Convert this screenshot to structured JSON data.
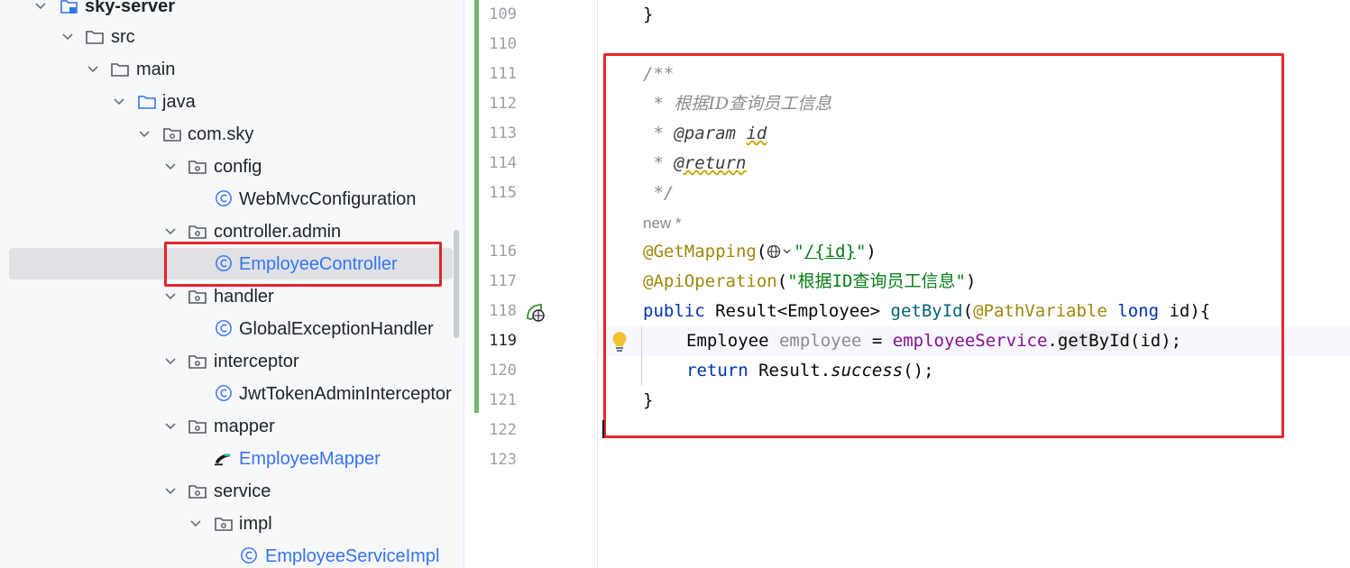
{
  "project_tree": {
    "items": [
      {
        "label": "sky-server",
        "type": "module",
        "bold": true
      },
      {
        "label": "src",
        "type": "folder"
      },
      {
        "label": "main",
        "type": "folder"
      },
      {
        "label": "java",
        "type": "source-folder"
      },
      {
        "label": "com.sky",
        "type": "package"
      },
      {
        "label": "config",
        "type": "package"
      },
      {
        "label": "WebMvcConfiguration",
        "type": "class"
      },
      {
        "label": "controller.admin",
        "type": "package"
      },
      {
        "label": "EmployeeController",
        "type": "class",
        "selected": true
      },
      {
        "label": "handler",
        "type": "package"
      },
      {
        "label": "GlobalExceptionHandler",
        "type": "class"
      },
      {
        "label": "interceptor",
        "type": "package"
      },
      {
        "label": "JwtTokenAdminInterceptor",
        "type": "class"
      },
      {
        "label": "mapper",
        "type": "package"
      },
      {
        "label": "EmployeeMapper",
        "type": "mybatis-mapper"
      },
      {
        "label": "service",
        "type": "package"
      },
      {
        "label": "impl",
        "type": "package"
      },
      {
        "label": "EmployeeServiceImpl",
        "type": "class"
      }
    ]
  },
  "editor": {
    "line_numbers": [
      "109",
      "110",
      "111",
      "112",
      "113",
      "114",
      "115",
      "116",
      "117",
      "118",
      "119",
      "120",
      "121",
      "122",
      "123"
    ],
    "current_line": "119",
    "code": {
      "l109": "}",
      "l111": "/**",
      "l112_star": " * ",
      "l112_text": "根据ID查询员工信息",
      "l113_star": " * ",
      "l113_tag": "@param",
      "l113_sp": " ",
      "l113_ref": "id",
      "l114_star": " * ",
      "l114_tag": "@return",
      "l115": " */",
      "inlay_new": "new *",
      "l116_ann": "@GetMapping",
      "l116_open": "(",
      "l116_str_q1": "\"",
      "l116_str_path": "/{id}",
      "l116_str_q2": "\"",
      "l116_close": ")",
      "l117_ann": "@ApiOperation",
      "l117_open": "(",
      "l117_str": "\"根据ID查询员工信息\"",
      "l117_close": ")",
      "l118_kw": "public",
      "l118_type": " Result<Employee> ",
      "l118_fn": "getById",
      "l118_open": "(",
      "l118_ann": "@PathVariable",
      "l118_sp": " ",
      "l118_kw2": "long",
      "l118_rest": " id){",
      "l119_type": "Employee ",
      "l119_var": "employee",
      "l119_eq": " = ",
      "l119_fld": "employeeService",
      "l119_dot": ".",
      "l119_call": "getById",
      "l119_rest": "(id);",
      "l120_kw": "return",
      "l120_mid": " Result.",
      "l120_call": "success",
      "l120_rest": "();",
      "l121": "}"
    }
  },
  "icons": [
    "chevron-down-icon",
    "folder-icon",
    "package-icon",
    "class-icon",
    "mapper-icon",
    "bean-icon",
    "globe-icon",
    "lightbulb-icon"
  ],
  "colors": {
    "highlight_box": "#e5262a",
    "selection": "#dfe1e5",
    "vcs_change": "#6fb56f",
    "link_blue": "#3574f0"
  }
}
